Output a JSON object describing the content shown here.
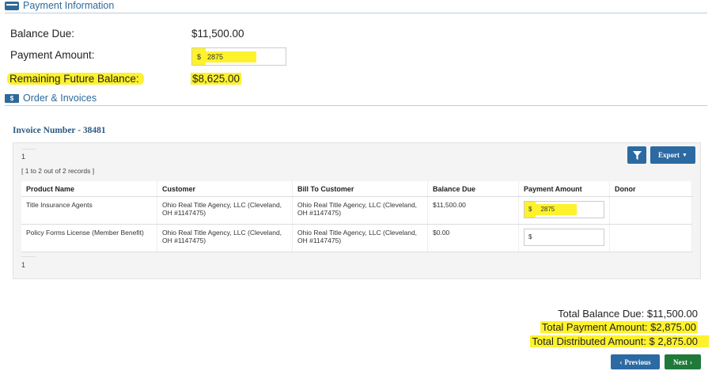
{
  "payment_section": {
    "title": "Payment Information",
    "balance_due_label": "Balance Due:",
    "balance_due_value": "$11,500.00",
    "payment_amount_label": "Payment Amount:",
    "payment_currency": "$",
    "payment_amount_value": "2875",
    "remaining_label": "Remaining Future Balance:",
    "remaining_value": "$8,625.00"
  },
  "orders_section": {
    "title": "Order & Invoices",
    "invoice_title": "Invoice Number - 38481",
    "page_number_top": "1",
    "records_info": "[ 1 to 2 out of 2 records ]",
    "export_label": "Export",
    "page_number_bottom": "1",
    "columns": [
      "Product Name",
      "Customer",
      "Bill To Customer",
      "Balance Due",
      "Payment Amount",
      "Donor"
    ],
    "rows": [
      {
        "product": "Title Insurance Agents",
        "customer": "Ohio Real Title Agency, LLC (Cleveland, OH #1147475)",
        "bill_to": "Ohio Real Title Agency, LLC (Cleveland, OH #1147475)",
        "balance": "$11,500.00",
        "currency": "$",
        "payment": "2875",
        "donor": ""
      },
      {
        "product": "Policy Forms License (Member Benefit)",
        "customer": "Ohio Real Title Agency, LLC (Cleveland, OH #1147475)",
        "bill_to": "Ohio Real Title Agency, LLC (Cleveland, OH #1147475)",
        "balance": "$0.00",
        "currency": "$",
        "payment": "",
        "donor": ""
      }
    ]
  },
  "totals": {
    "total_balance": "Total Balance Due: $11,500.00",
    "total_payment": "Total Payment Amount:  $2,875.00",
    "total_distributed": "Total Distributed Amount: $ 2,875.00"
  },
  "nav": {
    "previous_label": "Previous",
    "next_label": "Next"
  },
  "colors": {
    "accent": "#2d6a9a",
    "highlight": "#fdf22b",
    "next_button": "#1f7a3a"
  }
}
